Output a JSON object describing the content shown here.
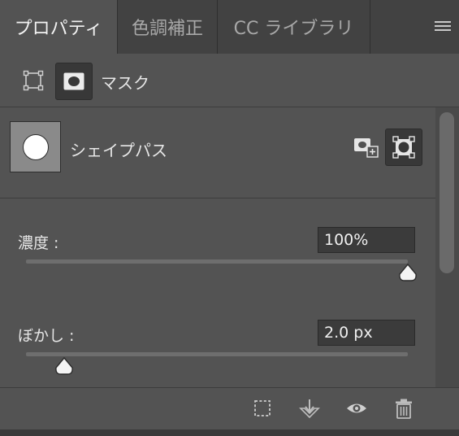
{
  "tabs": [
    {
      "label": "プロパティ",
      "active": true
    },
    {
      "label": "色調補正",
      "active": false
    },
    {
      "label": "CC ライブラリ",
      "active": false
    }
  ],
  "mask_header": {
    "label": "マスク",
    "pixel_mask_icon": "pixel-mask-icon",
    "vector_mask_icon": "vector-mask-icon"
  },
  "shape_path": {
    "label": "シェイプパス",
    "thumbnail_icon": "circle-shape-thumbnail",
    "add_mask_icon": "add-mask-icon",
    "select_mask_icon": "select-vector-mask-icon"
  },
  "density": {
    "label": "濃度 :",
    "value": "100%",
    "fraction": 1.0
  },
  "feather": {
    "label": "ぼかし :",
    "value": "2.0 px",
    "fraction": 0.1
  },
  "footer": {
    "icons": [
      "load-selection-icon",
      "apply-mask-icon",
      "visibility-eye-icon",
      "trash-icon"
    ]
  },
  "colors": {
    "panel_bg": "#535353",
    "tab_bg": "#424242",
    "field_bg": "#3b3b3b",
    "text": "#e6e6e6"
  }
}
